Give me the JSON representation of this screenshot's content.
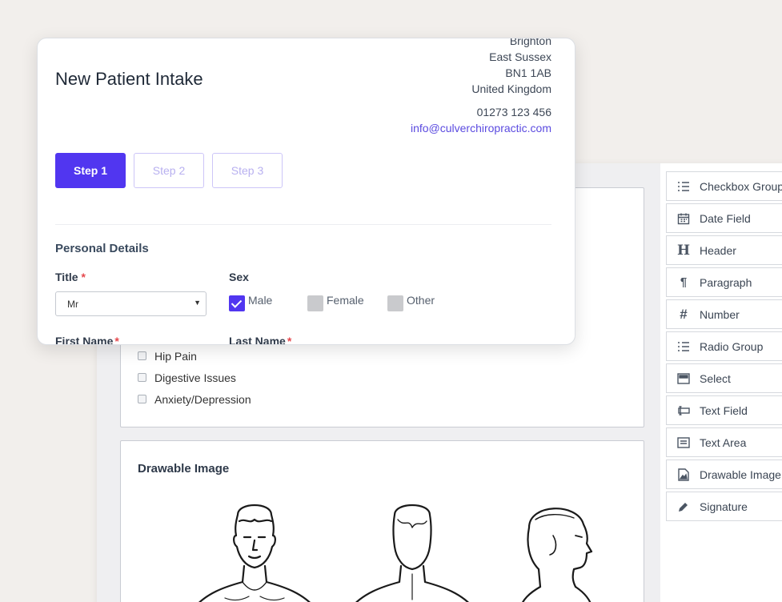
{
  "builder": {
    "conditions": [
      "Hip Pain",
      "Digestive Issues",
      "Anxiety/Depression"
    ],
    "drawable_title": "Drawable Image",
    "palette": [
      {
        "icon": "checkbox-group-icon",
        "label": "Checkbox Group"
      },
      {
        "icon": "calendar-icon",
        "label": "Date Field"
      },
      {
        "icon": "header-icon",
        "label": "Header"
      },
      {
        "icon": "paragraph-icon",
        "label": "Paragraph"
      },
      {
        "icon": "hash-icon",
        "label": "Number"
      },
      {
        "icon": "radio-group-icon",
        "label": "Radio Group"
      },
      {
        "icon": "select-icon",
        "label": "Select"
      },
      {
        "icon": "text-field-icon",
        "label": "Text Field"
      },
      {
        "icon": "text-area-icon",
        "label": "Text Area"
      },
      {
        "icon": "image-icon",
        "label": "Drawable Image"
      },
      {
        "icon": "pencil-icon",
        "label": "Signature"
      }
    ]
  },
  "modal": {
    "title": "New Patient Intake",
    "address": {
      "city": "Brighton",
      "county": "East Sussex",
      "postcode": "BN1 1AB",
      "country": "United Kingdom",
      "phone": "01273 123 456",
      "email": "info@culverchiropractic.com"
    },
    "steps": [
      "Step 1",
      "Step 2",
      "Step 3"
    ],
    "active_step": 0,
    "section_title": "Personal Details",
    "title_field": {
      "label": "Title",
      "value": "Mr"
    },
    "sex_field": {
      "label": "Sex",
      "options": [
        "Male",
        "Female",
        "Other"
      ],
      "checked": "Male"
    },
    "first_name_label": "First Name",
    "last_name_label": "Last Name",
    "required_mark": "*"
  },
  "colors": {
    "accent": "#5136f0",
    "background": "#f2efec"
  }
}
